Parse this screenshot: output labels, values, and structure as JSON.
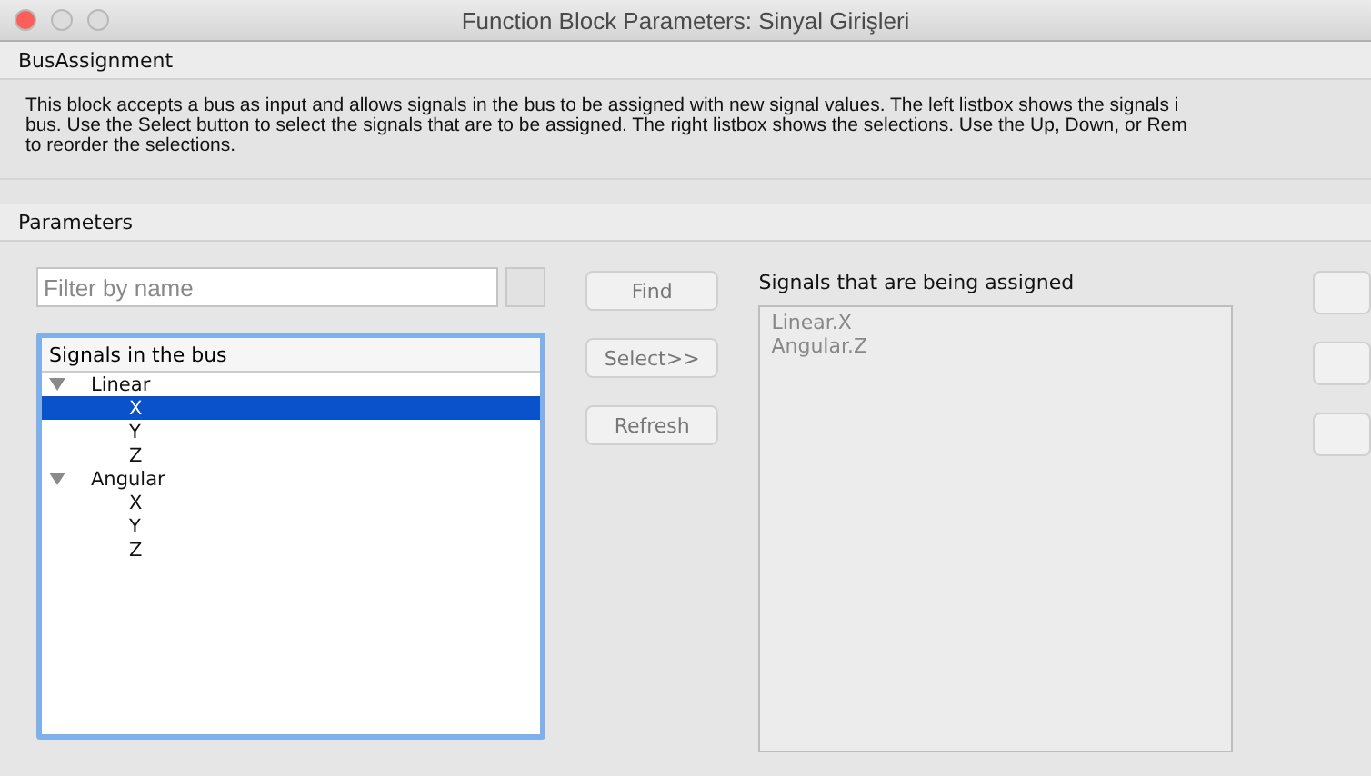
{
  "window": {
    "title": "Function Block Parameters: Sinyal Girişleri"
  },
  "bus_assignment": {
    "header": "BusAssignment",
    "description_lines": [
      "This block accepts a bus as input and allows signals in the bus to be assigned with new signal values. The left listbox shows the signals i",
      "bus. Use the Select button to select the signals that are to be assigned. The right listbox shows the selections. Use the Up, Down, or Rem",
      "to reorder the selections."
    ]
  },
  "parameters": {
    "header": "Parameters",
    "filter": {
      "placeholder": "Filter by name"
    },
    "tree": {
      "header": "Signals in the bus",
      "items": [
        {
          "label": "Linear",
          "expanded": true,
          "selected": false,
          "children": [
            {
              "label": "X",
              "selected": true
            },
            {
              "label": "Y",
              "selected": false
            },
            {
              "label": "Z",
              "selected": false
            }
          ]
        },
        {
          "label": "Angular",
          "expanded": true,
          "selected": false,
          "children": [
            {
              "label": "X",
              "selected": false
            },
            {
              "label": "Y",
              "selected": false
            },
            {
              "label": "Z",
              "selected": false
            }
          ]
        }
      ]
    },
    "buttons": [
      "Find",
      "Select>>",
      "Refresh"
    ],
    "assigned": {
      "label": "Signals that are being assigned",
      "items": [
        "Linear.X",
        "Angular.Z"
      ]
    }
  }
}
